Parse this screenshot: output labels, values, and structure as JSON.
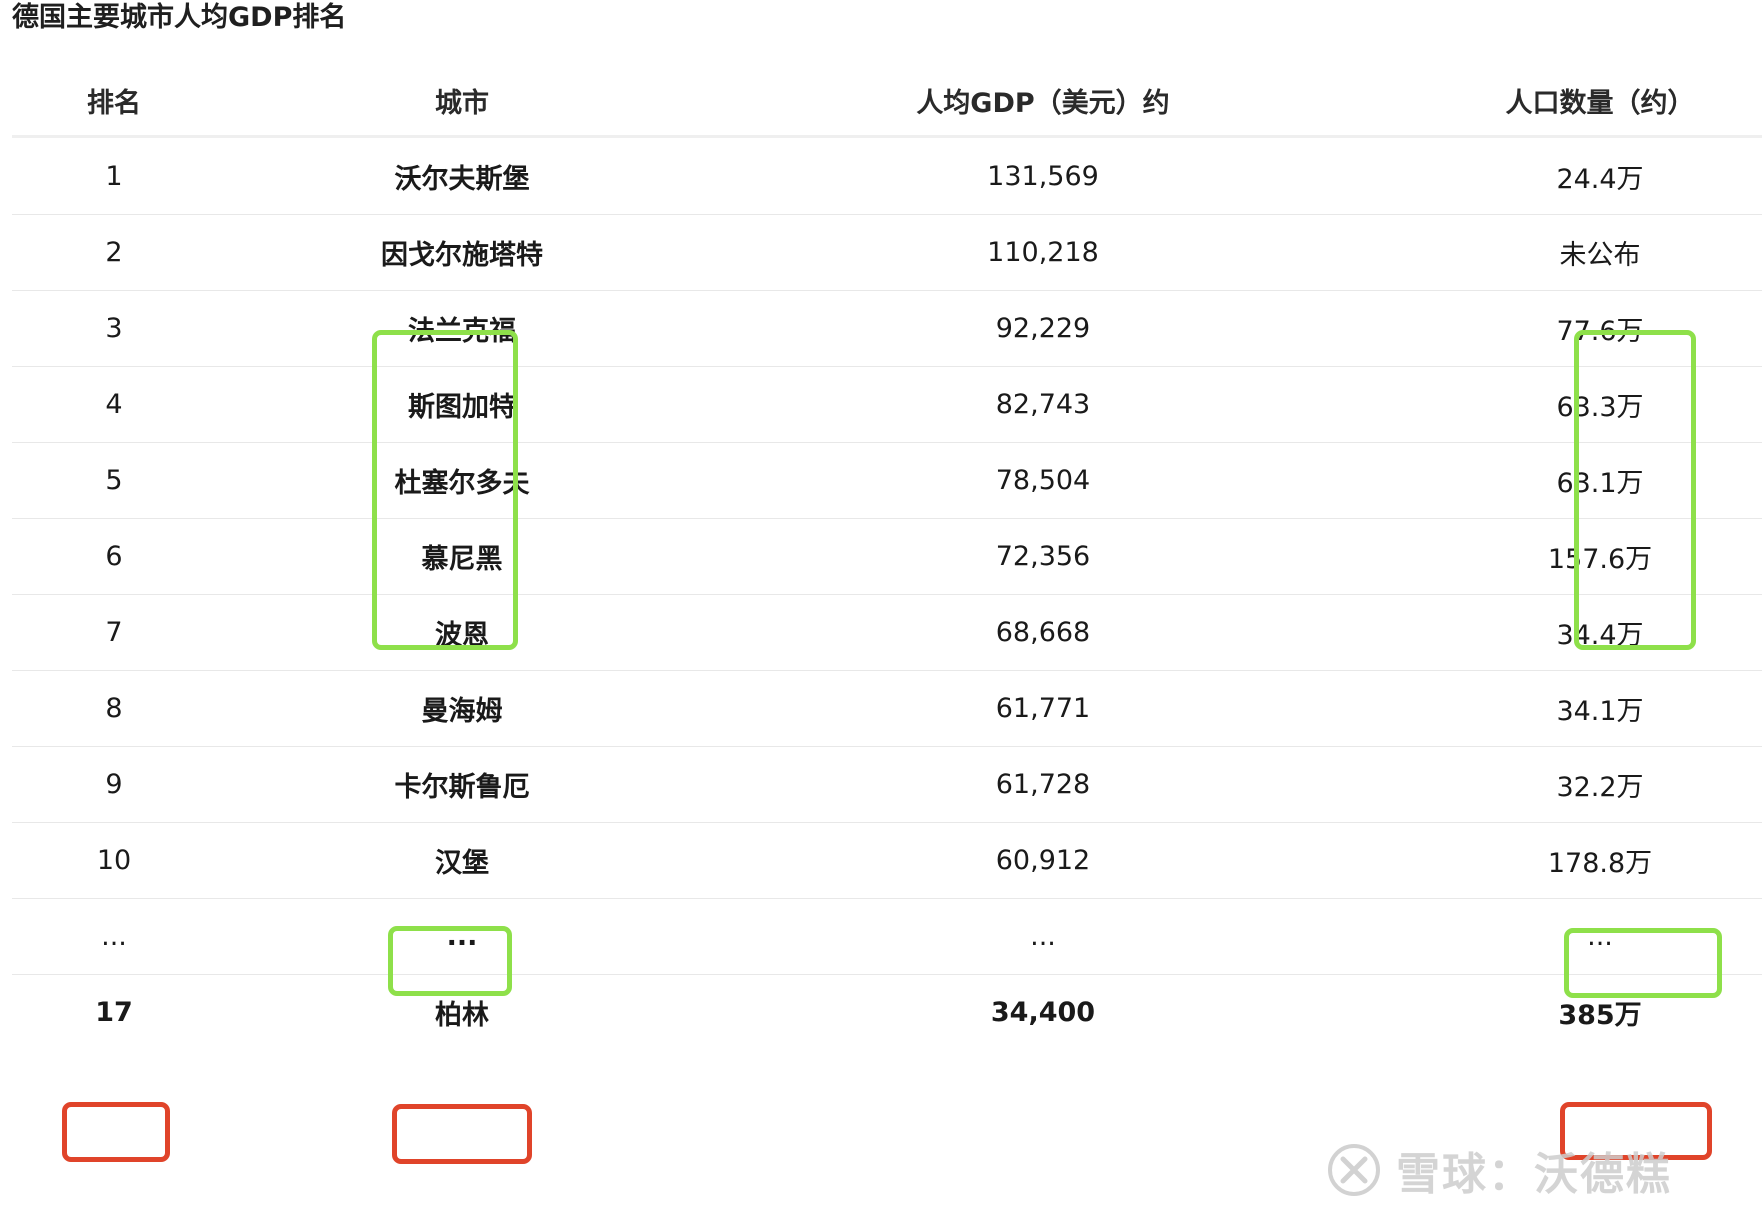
{
  "title": "德国主要城市人均GDP排名",
  "columns": [
    "排名",
    "城市",
    "人均GDP（美元）约",
    "人口数量（约）"
  ],
  "rows": [
    {
      "rank": "1",
      "city": "沃尔夫斯堡",
      "gdp": "131,569",
      "pop": "24.4万"
    },
    {
      "rank": "2",
      "city": "因戈尔施塔特",
      "gdp": "110,218",
      "pop": "未公布"
    },
    {
      "rank": "3",
      "city": "法兰克福",
      "gdp": "92,229",
      "pop": "77.6万"
    },
    {
      "rank": "4",
      "city": "斯图加特",
      "gdp": "82,743",
      "pop": "63.3万"
    },
    {
      "rank": "5",
      "city": "杜塞尔多夫",
      "gdp": "78,504",
      "pop": "63.1万"
    },
    {
      "rank": "6",
      "city": "慕尼黑",
      "gdp": "72,356",
      "pop": "157.6万"
    },
    {
      "rank": "7",
      "city": "波恩",
      "gdp": "68,668",
      "pop": "34.4万"
    },
    {
      "rank": "8",
      "city": "曼海姆",
      "gdp": "61,771",
      "pop": "34.1万"
    },
    {
      "rank": "9",
      "city": "卡尔斯鲁厄",
      "gdp": "61,728",
      "pop": "32.2万"
    },
    {
      "rank": "10",
      "city": "汉堡",
      "gdp": "60,912",
      "pop": "178.8万"
    },
    {
      "rank": "...",
      "city": "...",
      "gdp": "...",
      "pop": "..."
    },
    {
      "rank": "17",
      "city": "柏林",
      "gdp": "34,400",
      "pop": "385万"
    }
  ],
  "watermark": {
    "text": "雪球：沃德糕",
    "icon": "xueqiu-logo-icon"
  },
  "colors": {
    "highlight_green": "#8ee04a",
    "highlight_red": "#e0442a"
  }
}
